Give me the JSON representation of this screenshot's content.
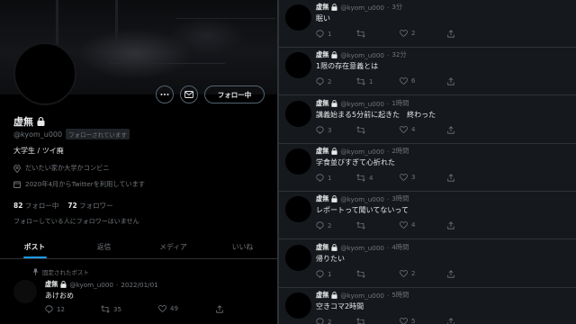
{
  "profile": {
    "display_name": "虚無",
    "handle": "@kyom_u000",
    "follows_you": "フォローされています",
    "follow_button": "フォロー中",
    "bio": "大学生 / ツイ廃",
    "location": "だいたい家か大学かコンビニ",
    "joined": "2020年4月からTwitterを利用しています",
    "following_count": "82",
    "following_label": "フォロー中",
    "followers_count": "72",
    "followers_label": "フォロワー",
    "known_followers_note": "フォローしている人にフォロワーはいません"
  },
  "tabs": [
    {
      "label": "ポスト",
      "active": true
    },
    {
      "label": "返信",
      "active": false
    },
    {
      "label": "メディア",
      "active": false
    },
    {
      "label": "いいね",
      "active": false
    }
  ],
  "pinned": {
    "label": "固定されたポスト",
    "name": "虚無",
    "handle": "@kyom_u000",
    "sep": "·",
    "date": "2022/01/01",
    "text": "あけおめ",
    "replies": "12",
    "reposts": "35",
    "likes": "49"
  },
  "timeline": [
    {
      "name": "虚無",
      "handle": "@kyom_u000",
      "sep": "·",
      "time": "3分",
      "text": "眠い",
      "replies": "1",
      "reposts": "",
      "likes": "2"
    },
    {
      "name": "虚無",
      "handle": "@kyom_u000",
      "sep": "·",
      "time": "32分",
      "text": "1限の存在意義とは",
      "replies": "2",
      "reposts": "1",
      "likes": "6"
    },
    {
      "name": "虚無",
      "handle": "@kyom_u000",
      "sep": "·",
      "time": "1時間",
      "text": "講義始まる5分前に起きた　終わった",
      "replies": "3",
      "reposts": "",
      "likes": "4"
    },
    {
      "name": "虚無",
      "handle": "@kyom_u000",
      "sep": "·",
      "time": "2時間",
      "text": "学食並びすぎて心折れた",
      "replies": "1",
      "reposts": "4",
      "likes": "3"
    },
    {
      "name": "虚無",
      "handle": "@kyom_u000",
      "sep": "·",
      "time": "3時間",
      "text": "レポートって聞いてないって",
      "replies": "2",
      "reposts": "",
      "likes": "4"
    },
    {
      "name": "虚無",
      "handle": "@kyom_u000",
      "sep": "·",
      "time": "4時間",
      "text": "帰りたい",
      "replies": "1",
      "reposts": "",
      "likes": "2"
    },
    {
      "name": "虚無",
      "handle": "@kyom_u000",
      "sep": "·",
      "time": "5時間",
      "text": "空きコマ2時間",
      "replies": "2",
      "reposts": "",
      "likes": "5"
    }
  ],
  "colors": {
    "accent": "#1d9bf0",
    "muted": "#71767b",
    "text": "#e7e9ea",
    "timeline_bg": "#15181c"
  },
  "icons": [
    "more-icon",
    "mail-icon",
    "lock-icon",
    "location-icon",
    "calendar-icon",
    "pin-icon",
    "reply-icon",
    "repost-icon",
    "like-icon",
    "share-icon"
  ]
}
